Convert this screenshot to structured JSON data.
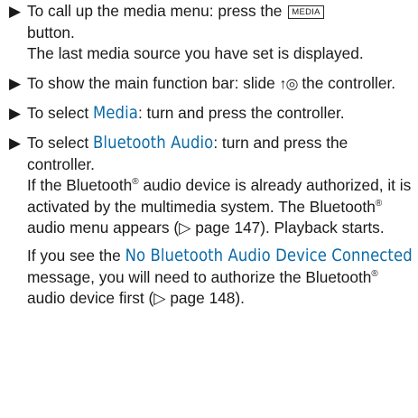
{
  "bullet": "▶",
  "step1": {
    "text_before": "To call up the media menu: press the",
    "button_label": "MEDIA",
    "text_after": "button.",
    "result": "The last media source you have set is dis­played."
  },
  "step2": {
    "text_before": "To show the main function bar: slide",
    "controller_icon": "↑◎",
    "text_after": "the controller."
  },
  "step3": {
    "text_before": "To select",
    "item": "Media",
    "text_after": ": turn and press the controller."
  },
  "step4": {
    "text_before": "To select",
    "item": "Bluetooth Audio",
    "text_after": ": turn and press the controller.",
    "p1_a": "If the Bluetooth",
    "registered": "®",
    "p1_b": " audio device is already authorized, it is activated by the multimedia system. The Bluetooth",
    "p1_c": " audio menu appears (▷ page 147). Playback starts.",
    "p2_a": "If you see the",
    "message": "No Bluetooth Audio Device Connected",
    "p2_b": "message, you will need to author­ize the Bluetooth",
    "p2_c": " audio device first (▷ page 148)."
  }
}
